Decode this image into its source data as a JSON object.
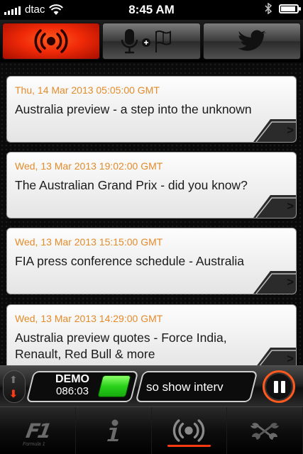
{
  "status_bar": {
    "carrier": "dtac",
    "time": "8:45 AM"
  },
  "top_tabs": [
    {
      "name": "live-commentary",
      "icon": "broadcast-icon",
      "active": true
    },
    {
      "name": "audio-flags",
      "icon": "microphone-plus-flag-icon",
      "active": false
    },
    {
      "name": "twitter",
      "icon": "twitter-bird-icon",
      "active": false
    }
  ],
  "news": [
    {
      "date": "Thu, 14 Mar 2013 05:05:00 GMT",
      "title": "Australia preview - a step into the unknown"
    },
    {
      "date": "Wed, 13 Mar 2013 19:02:00 GMT",
      "title": "The Australian Grand Prix - did you know?"
    },
    {
      "date": "Wed, 13 Mar 2013 15:15:00 GMT",
      "title": "FIA press conference schedule - Australia"
    },
    {
      "date": "Wed, 13 Mar 2013 14:29:00 GMT",
      "title": "Australia preview quotes - Force India, Renault, Red Bull & more"
    }
  ],
  "player": {
    "mode": "DEMO",
    "clock": "086:03",
    "ticker": "so show interv",
    "flag_color": "#29d11a",
    "accent": "#ff5a1e"
  },
  "bottom_tabs": [
    {
      "name": "f1-logo",
      "label": "F1",
      "sub": "Formula 1",
      "active": false
    },
    {
      "name": "info",
      "icon": "info-icon",
      "active": false
    },
    {
      "name": "live",
      "icon": "broadcast-icon",
      "active": true
    },
    {
      "name": "settings",
      "icon": "wrench-icon",
      "active": false
    }
  ]
}
